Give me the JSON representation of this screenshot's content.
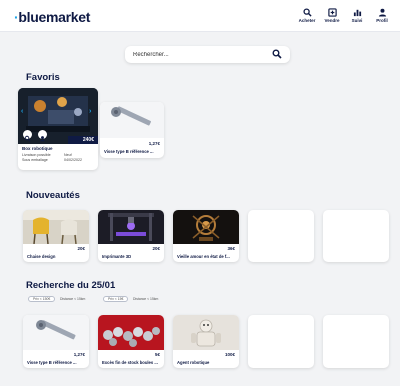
{
  "header": {
    "logo_prefix": "·",
    "logo_text": "bluemarket",
    "nav": [
      {
        "label": "Acheter",
        "icon": "search-icon"
      },
      {
        "label": "Vendre",
        "icon": "plus-box-icon"
      },
      {
        "label": "Suivi",
        "icon": "bar-chart-icon"
      },
      {
        "label": "Profil",
        "icon": "user-icon"
      }
    ]
  },
  "search": {
    "placeholder": "Rechercher..."
  },
  "favoris": {
    "title": "Favoris",
    "main": {
      "price": "240€",
      "title": "Box robotique",
      "meta_left": [
        "Livraison possible",
        "Sous emballage"
      ],
      "meta_right": [
        "Neuf",
        "04/02/2022"
      ]
    },
    "second": {
      "price": "1,27€",
      "title": "Visse type B référence ..."
    }
  },
  "nouveautes": {
    "title": "Nouveautés",
    "items": [
      {
        "price": "20€",
        "title": "Chaise design"
      },
      {
        "price": "20€",
        "title": "Imprimante 3D"
      },
      {
        "price": "36€",
        "title": "Vieille amour en état de f..."
      }
    ]
  },
  "recherche": {
    "title": "Recherche du 25/01",
    "filters": [
      "Prix < 150€",
      "Distance < 15km",
      "Prix < 15€",
      "Distance < 15km"
    ],
    "items": [
      {
        "price": "1,27€",
        "title": "Visse type B référence ..."
      },
      {
        "price": "5€",
        "title": "Excès fin de stock boules ..."
      },
      {
        "price": "100€",
        "title": "Agent robotique"
      }
    ]
  },
  "colors": {
    "accent": "#1aa3e8",
    "navy": "#0f1a44",
    "background": "#f2f3f5"
  }
}
